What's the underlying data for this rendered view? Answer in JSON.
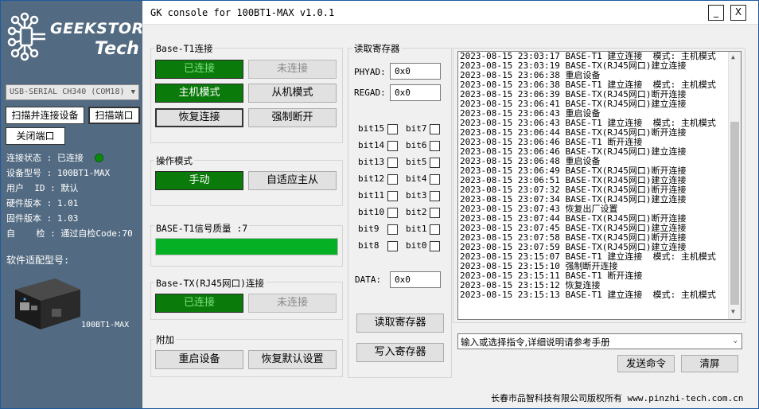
{
  "window": {
    "title": "GK console for 100BT1-MAX v1.0.1",
    "minimize_label": "_",
    "close_label": "X"
  },
  "logo": {
    "line1": "GEEKSTORE",
    "line2": "Tech"
  },
  "sidebar": {
    "port_select": "USB-SERIAL CH340 (COM18)",
    "scan_connect_label": "扫描并连接设备",
    "scan_port_label": "扫描端口",
    "close_port_label": "关闭端口",
    "info": {
      "conn_status": "连接状态 : 已连接",
      "device_model": "设备型号 : 100BT1-MAX",
      "user_id": "用户  ID : 默认",
      "hw_version": "硬件版本 : 1.01",
      "fw_version": "固件版本 : 1.03",
      "self_check": "自    检 : 通过自检Code:70"
    },
    "supported_models_label": "软件适配型号:",
    "device_name": "100BT1-MAX",
    "status_color": "#0a8a0a"
  },
  "base_t1": {
    "title": "Base-T1连接",
    "connected": "已连接",
    "disconnected": "未连接",
    "master_mode": "主机模式",
    "slave_mode": "从机模式",
    "restore_conn": "恢复连接",
    "force_disconnect": "强制断开"
  },
  "op_mode": {
    "title": "操作模式",
    "manual": "手动",
    "auto_master": "自适应主从"
  },
  "signal": {
    "title": "BASE-T1信号质量 :7",
    "level_fraction": 1.0
  },
  "base_tx": {
    "title": "Base-TX(RJ45网口)连接",
    "connected": "已连接",
    "disconnected": "未连接"
  },
  "extra": {
    "title": "附加",
    "reboot": "重启设备",
    "factory_reset": "恢复默认设置"
  },
  "registers": {
    "title": "读取寄存器",
    "phyad_label": "PHYAD:",
    "phyad_value": "0x0",
    "regad_label": "REGAD:",
    "regad_value": "0x0",
    "bits": [
      [
        "bit15",
        "bit7"
      ],
      [
        "bit14",
        "bit6"
      ],
      [
        "bit13",
        "bit5"
      ],
      [
        "bit12",
        "bit4"
      ],
      [
        "bit11",
        "bit3"
      ],
      [
        "bit10",
        "bit2"
      ],
      [
        "bit9",
        "bit1"
      ],
      [
        "bit8",
        "bit0"
      ]
    ],
    "data_label": "DATA:",
    "data_value": "0x0",
    "read_btn": "读取寄存器",
    "write_btn": "写入寄存器"
  },
  "log": [
    "2023-08-15 23:03:17 BASE-T1 建立连接  模式: 主机模式",
    "2023-08-15 23:03:19 BASE-TX(RJ45网口)建立连接",
    "2023-08-15 23:06:38 重启设备",
    "2023-08-15 23:06:38 BASE-T1 建立连接  模式: 主机模式",
    "2023-08-15 23:06:39 BASE-TX(RJ45网口)断开连接",
    "2023-08-15 23:06:41 BASE-TX(RJ45网口)建立连接",
    "2023-08-15 23:06:43 重启设备",
    "2023-08-15 23:06:43 BASE-T1 建立连接  模式: 主机模式",
    "2023-08-15 23:06:44 BASE-TX(RJ45网口)断开连接",
    "2023-08-15 23:06:46 BASE-T1 断开连接",
    "2023-08-15 23:06:46 BASE-TX(RJ45网口)建立连接",
    "2023-08-15 23:06:48 重启设备",
    "2023-08-15 23:06:49 BASE-TX(RJ45网口)断开连接",
    "2023-08-15 23:06:51 BASE-TX(RJ45网口)建立连接",
    "2023-08-15 23:07:32 BASE-TX(RJ45网口)断开连接",
    "2023-08-15 23:07:34 BASE-TX(RJ45网口)建立连接",
    "2023-08-15 23:07:43 恢复出厂设置",
    "2023-08-15 23:07:44 BASE-TX(RJ45网口)断开连接",
    "2023-08-15 23:07:45 BASE-TX(RJ45网口)建立连接",
    "2023-08-15 23:07:58 BASE-TX(RJ45网口)断开连接",
    "2023-08-15 23:07:59 BASE-TX(RJ45网口)建立连接",
    "2023-08-15 23:15:07 BASE-T1 建立连接  模式: 主机模式",
    "2023-08-15 23:15:10 强制断开连接",
    "2023-08-15 23:15:11 BASE-T1 断开连接",
    "2023-08-15 23:15:12 恢复连接",
    "2023-08-15 23:15:13 BASE-T1 建立连接  模式: 主机模式"
  ],
  "command": {
    "placeholder": "输入或选择指令,详细说明请参考手册",
    "send_btn": "发送命令",
    "clear_btn": "清屏"
  },
  "footer": "长春市品智科技有限公司版权所有 www.pinzhi-tech.com.cn"
}
